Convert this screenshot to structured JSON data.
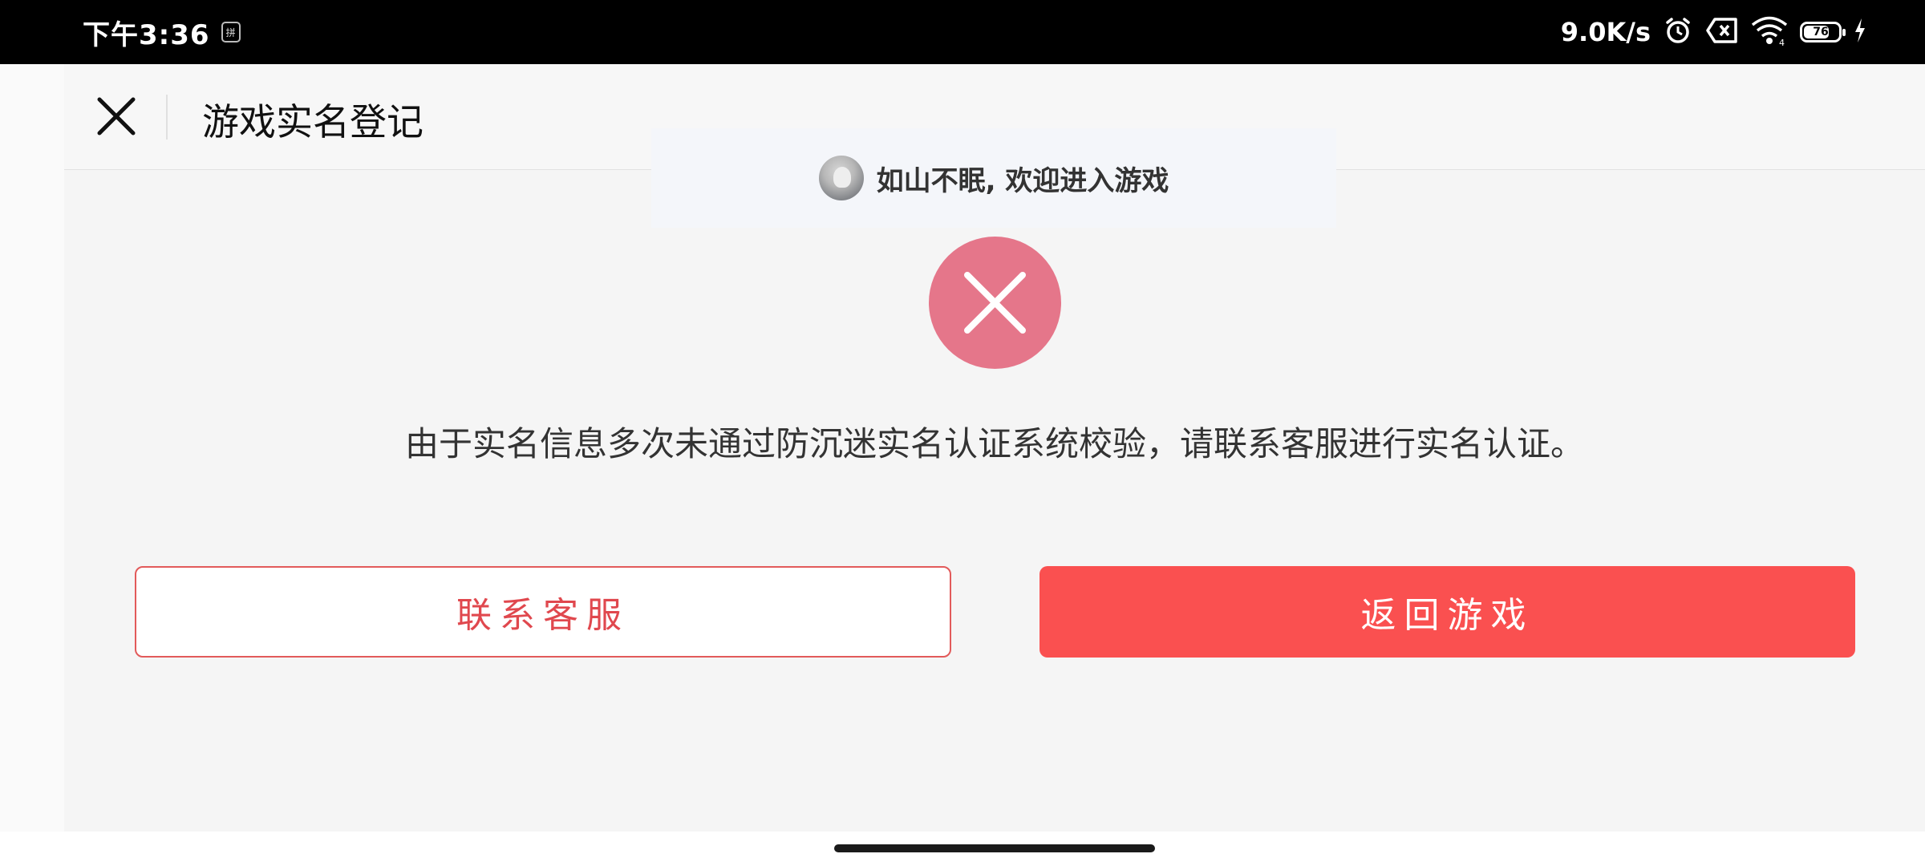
{
  "status_bar": {
    "time": "下午3:36",
    "ime_label": "拼",
    "network_speed": "9.0K/s",
    "battery_level": "76",
    "icons": [
      "alarm-icon",
      "sim-disabled-icon",
      "wifi-icon",
      "battery-icon",
      "charging-icon"
    ]
  },
  "header": {
    "title": "游戏实名登记",
    "close_icon": "close-icon"
  },
  "toast": {
    "message": "如山不眠, 欢迎进入游戏"
  },
  "main": {
    "error_icon": "error-x-icon",
    "message": "由于实名信息多次未通过防沉迷实名认证系统校验，请联系客服进行实名认证。",
    "contact_button": "联系客服",
    "return_button": "返回游戏"
  },
  "colors": {
    "accent_red": "#fa5050",
    "error_circle": "#e5768a",
    "toast_bg": "#f4f6fa"
  }
}
